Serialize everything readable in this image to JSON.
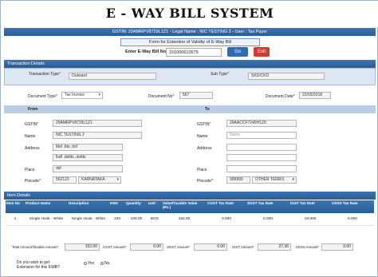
{
  "header": {
    "title": "E - WAY BILL SYSTEM",
    "info_bar": "GSTIN: 29AMRPV8729L1Z1 - Legal Name : NIC TESTING 2 - User : Tax Payer"
  },
  "form": {
    "title": "Form for Extention of Validity of E-Way Bill",
    "ewb_label": "Enter E-Way Bill No:",
    "ewb_value": "151000610679",
    "go_label": "Go",
    "exit_label": "Exit"
  },
  "transaction": {
    "section_title": "Transaction Details",
    "type_label": "Transaction Type",
    "type_value": "Outward",
    "subtype_label": "Sub Type",
    "subtype_value": "SKD/CKD",
    "doc_type_label": "Document Type",
    "doc_type_value": "Tax Invoice",
    "doc_no_label": "Document No",
    "doc_no_value": "567",
    "doc_date_label": "Document Date",
    "doc_date_value": "22/03/2018"
  },
  "from": {
    "title": "From",
    "gstin_label": "GSTIN",
    "gstin_value": "29AMRPV8729L1Z1",
    "name_label": "Name",
    "name_value": "NIC TESTING 2",
    "address_label": "Address",
    "address_line1": "fdsf ,fds ,dsf",
    "address_line2": "fsdf ,dsfds ,dsfds",
    "place_label": "Place",
    "place_value": "dsf",
    "pincode_label": "Pincode",
    "pincode_value": "562123",
    "state_value": "KARNATAKA"
  },
  "to": {
    "title": "To",
    "gstin_label": "GSTIN",
    "gstin_value": "29AACCF7245H1Z0",
    "name_label": "Name",
    "name_placeholder": "Name",
    "address_label": "Address",
    "place_label": "Place",
    "pincode_label": "Pincode",
    "pincode_value": "999999",
    "state_value": "OTHER TERRI1"
  },
  "items": {
    "section_title": "Item Details",
    "columns": [
      "Item No",
      "Product Name",
      "Description",
      "HSN",
      "Quantity",
      "Unit",
      "Value/Taxable Value (Rs.)",
      "CGST Tax Rate",
      "SGST Tax Rate",
      "IGST Tax Rate",
      "CESS Tax Rate"
    ],
    "rows": [
      [
        "1",
        "Single Hook - White",
        "Single Hook - White",
        "100",
        "100.00",
        "BOX",
        "152.00",
        "0.000",
        "0.000",
        "18.000",
        "0.000"
      ]
    ]
  },
  "totals": {
    "total_label": "Total Amount/Taxable Amount",
    "total_value": "152.00",
    "cgst_label": "CGST Amount",
    "cgst_value": "0.00",
    "sgst_label": "SGST Amount",
    "sgst_value": "0.00",
    "igst_label": "IGST Amount",
    "igst_value": "27.36",
    "cess_label": "CESS Amount",
    "cess_value": "0.00"
  },
  "extension": {
    "question_line1": "Do you wish to get",
    "question_line2": "Extension for this EWB?",
    "yes_label": "Yes",
    "no_label": "No"
  }
}
